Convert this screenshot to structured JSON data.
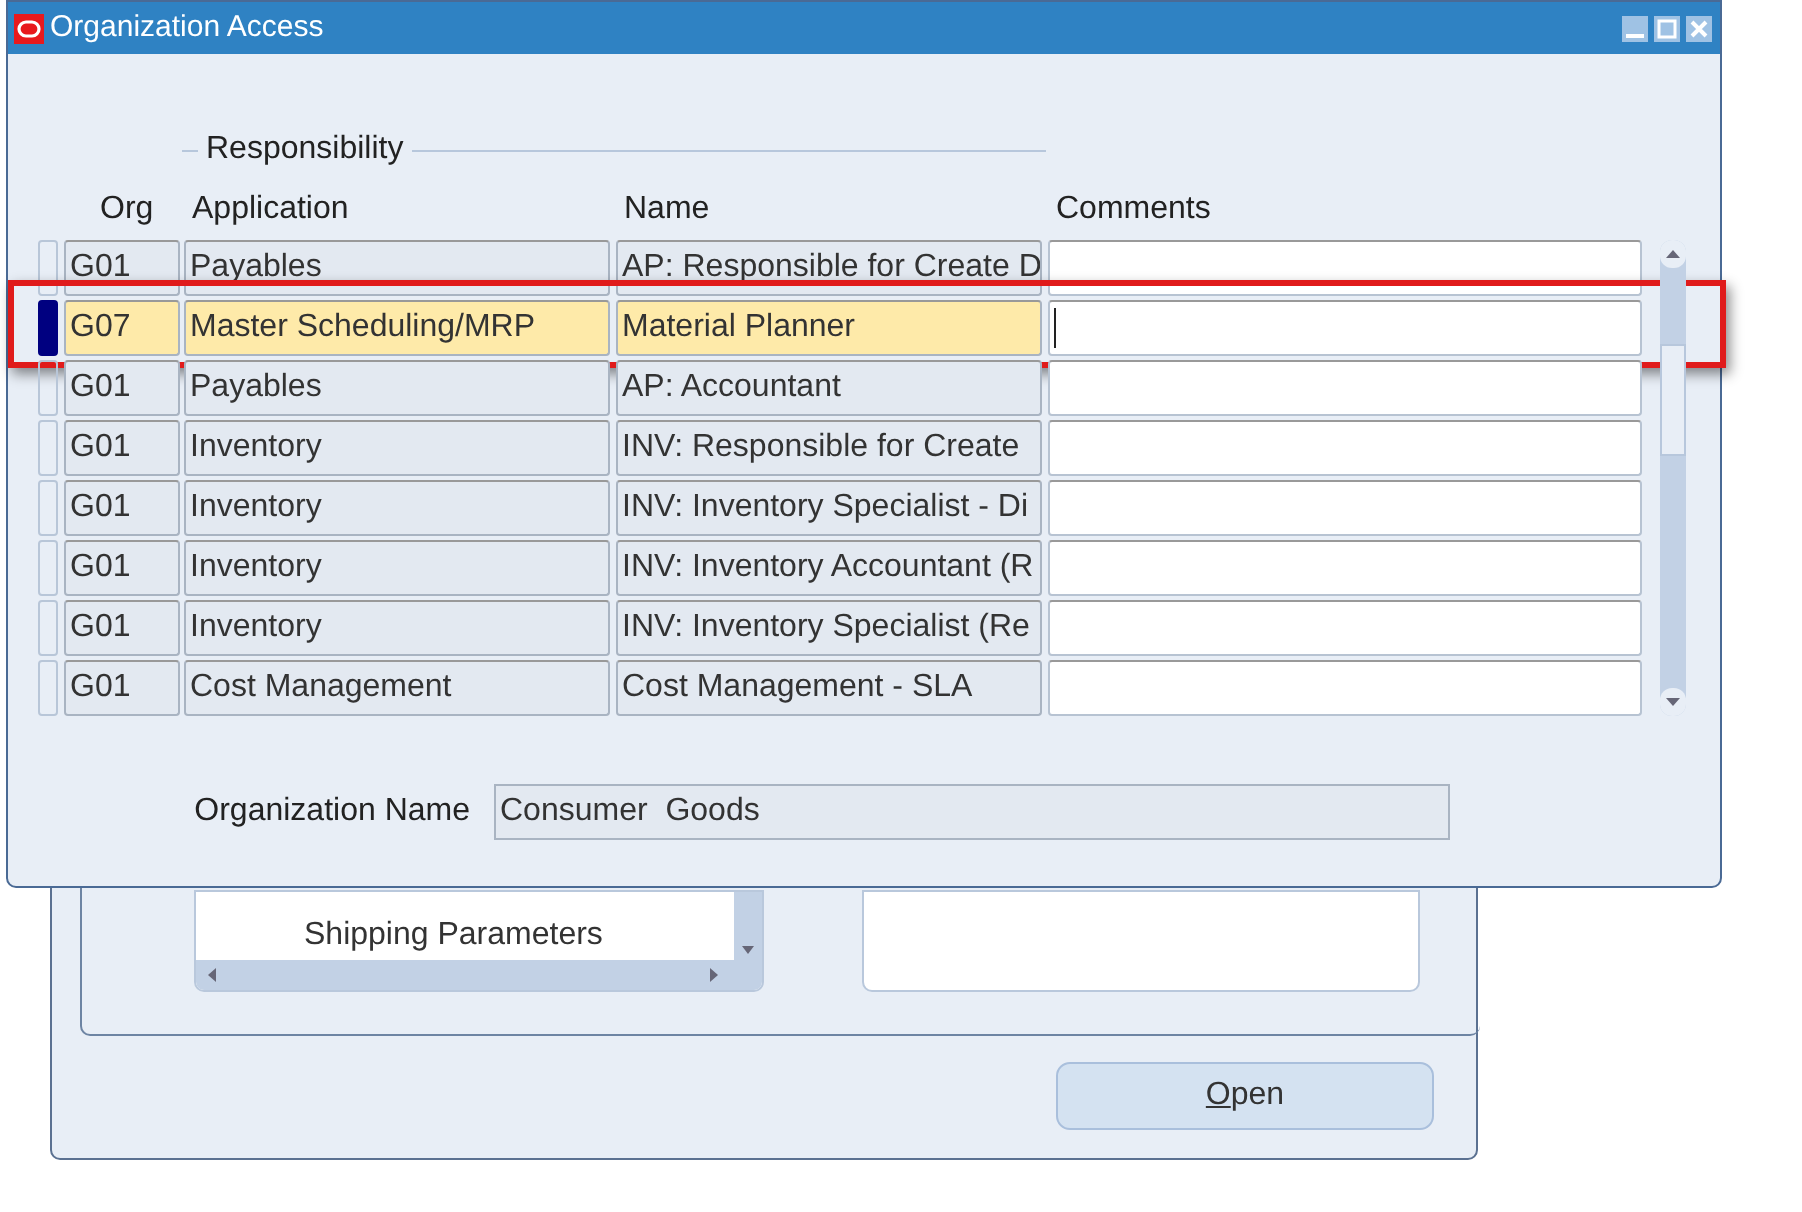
{
  "background_window": {
    "list_items": [
      "Shipping Parameters"
    ],
    "button": {
      "label": "Open"
    }
  },
  "window": {
    "title": "Organization Access"
  },
  "section_title": "Responsibility",
  "columns": [
    "Org",
    "Application",
    "Name",
    "Comments"
  ],
  "rows": [
    {
      "org": "G01",
      "application": "Payables",
      "name": "AP: Responsible for Create D",
      "selected": false
    },
    {
      "org": "G07",
      "application": "Master Scheduling/MRP",
      "name": "Material Planner",
      "selected": true
    },
    {
      "org": "G01",
      "application": "Payables",
      "name": "AP: Accountant",
      "selected": false
    },
    {
      "org": "G01",
      "application": "Inventory",
      "name": "INV: Responsible for Create",
      "selected": false
    },
    {
      "org": "G01",
      "application": "Inventory",
      "name": "INV: Inventory Specialist - Di",
      "selected": false
    },
    {
      "org": "G01",
      "application": "Inventory",
      "name": "INV: Inventory Accountant (R",
      "selected": false
    },
    {
      "org": "G01",
      "application": "Inventory",
      "name": "INV: Inventory Specialist (Re",
      "selected": false
    },
    {
      "org": "G01",
      "application": "Cost Management",
      "name": "Cost Management - SLA",
      "selected": false
    }
  ],
  "organization_name": {
    "label": "Organization Name",
    "value": "Consumer  Goods"
  }
}
